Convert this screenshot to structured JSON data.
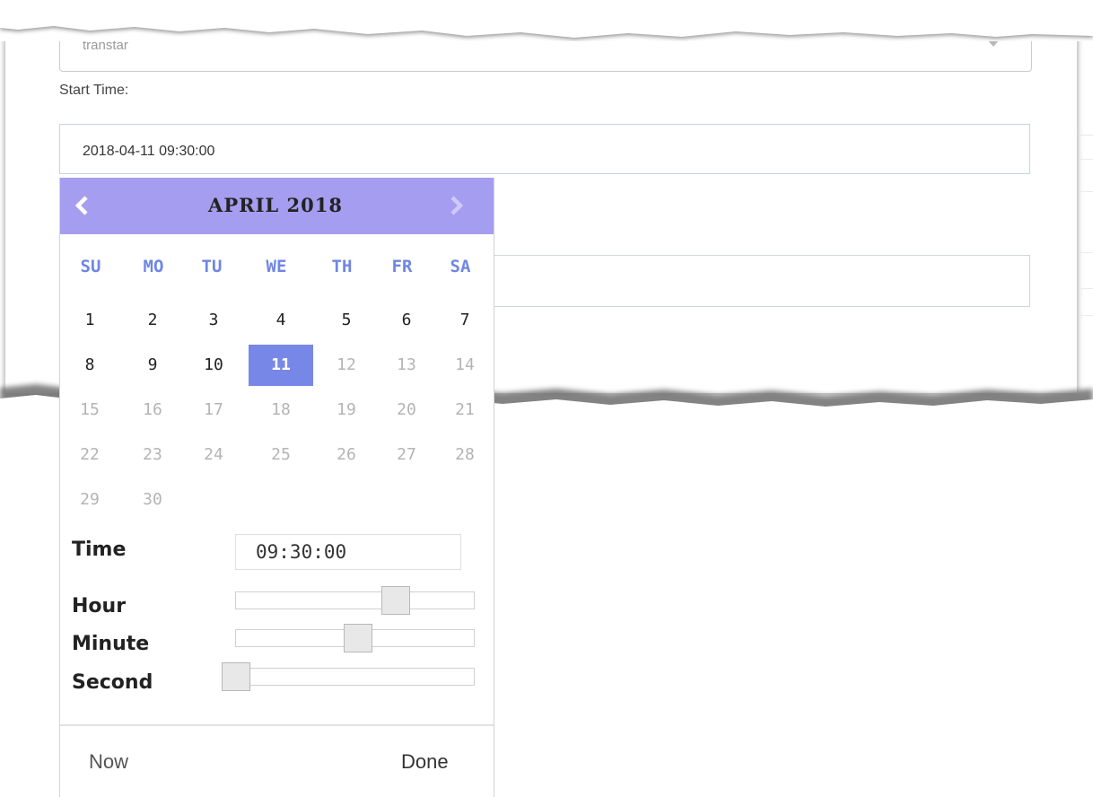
{
  "form": {
    "select_value": "transtar",
    "start_time_label": "Start Time:",
    "start_time_value": "2018-04-11 09:30:00",
    "end_time_value": ""
  },
  "datepicker": {
    "month_title": "APRIL 2018",
    "prev_icon": "chevron-left-icon",
    "next_icon": "chevron-right-icon",
    "header_color": "#a59df0",
    "selected_color": "#7787e8",
    "weekdays": [
      "SU",
      "MO",
      "TU",
      "WE",
      "TH",
      "FR",
      "SA"
    ],
    "weeks": [
      [
        "1",
        "2",
        "3",
        "4",
        "5",
        "6",
        "7"
      ],
      [
        "8",
        "9",
        "10",
        "11",
        "12",
        "13",
        "14"
      ],
      [
        "15",
        "16",
        "17",
        "18",
        "19",
        "20",
        "21"
      ],
      [
        "22",
        "23",
        "24",
        "25",
        "26",
        "27",
        "28"
      ],
      [
        "29",
        "30"
      ]
    ],
    "selected_day": "11",
    "last_enabled_day": 11,
    "time_label": "Time",
    "time_value": "09:30:00",
    "hour_label": "Hour",
    "minute_label": "Minute",
    "second_label": "Second",
    "hour_value": 9,
    "minute_value": 30,
    "second_value": 0,
    "now_label": "Now",
    "done_label": "Done"
  }
}
